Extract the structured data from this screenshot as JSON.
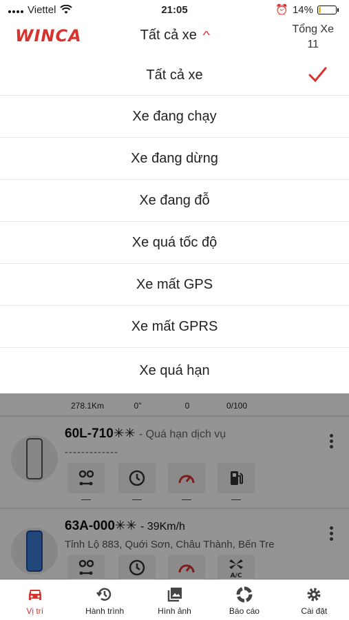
{
  "status": {
    "carrier": "Viettel",
    "time": "21:05",
    "battery": "14%",
    "battery_level": 0.14
  },
  "header": {
    "logo": "WINCA",
    "filter_label": "Tất cả xe",
    "total_label": "Tổng Xe",
    "total_count": "11"
  },
  "dropdown": {
    "options": [
      {
        "label": "Tất cả xe",
        "selected": true
      },
      {
        "label": "Xe đang chạy"
      },
      {
        "label": "Xe đang dừng"
      },
      {
        "label": "Xe đang đỗ"
      },
      {
        "label": "Xe quá tốc độ"
      },
      {
        "label": "Xe mất GPS"
      },
      {
        "label": "Xe mất GPRS"
      },
      {
        "label": "Xe quá hạn"
      }
    ]
  },
  "list": {
    "summary": {
      "distance": "278.1Km",
      "time": "0\"",
      "speed": "0",
      "fuel": "0/100"
    },
    "vehicles": [
      {
        "plate": "60L-710✳✳",
        "status": "- Quá hạn dịch vụ",
        "address": "-------------",
        "stats": [
          "—",
          "—",
          "—",
          "—"
        ]
      },
      {
        "plate": "63A-000✳✳",
        "status": "- 39Km/h",
        "address": "Tỉnh Lộ 883, Quới Sơn, Châu Thành, Bến Tre"
      }
    ]
  },
  "nav": {
    "items": [
      {
        "label": "Vị trí",
        "icon": "car-icon",
        "active": true
      },
      {
        "label": "Hành trình",
        "icon": "history-icon"
      },
      {
        "label": "Hình ảnh",
        "icon": "gallery-icon"
      },
      {
        "label": "Báo cáo",
        "icon": "report-icon"
      },
      {
        "label": "Cài đặt",
        "icon": "gear-icon"
      }
    ]
  },
  "colors": {
    "brand": "#d8322e"
  }
}
